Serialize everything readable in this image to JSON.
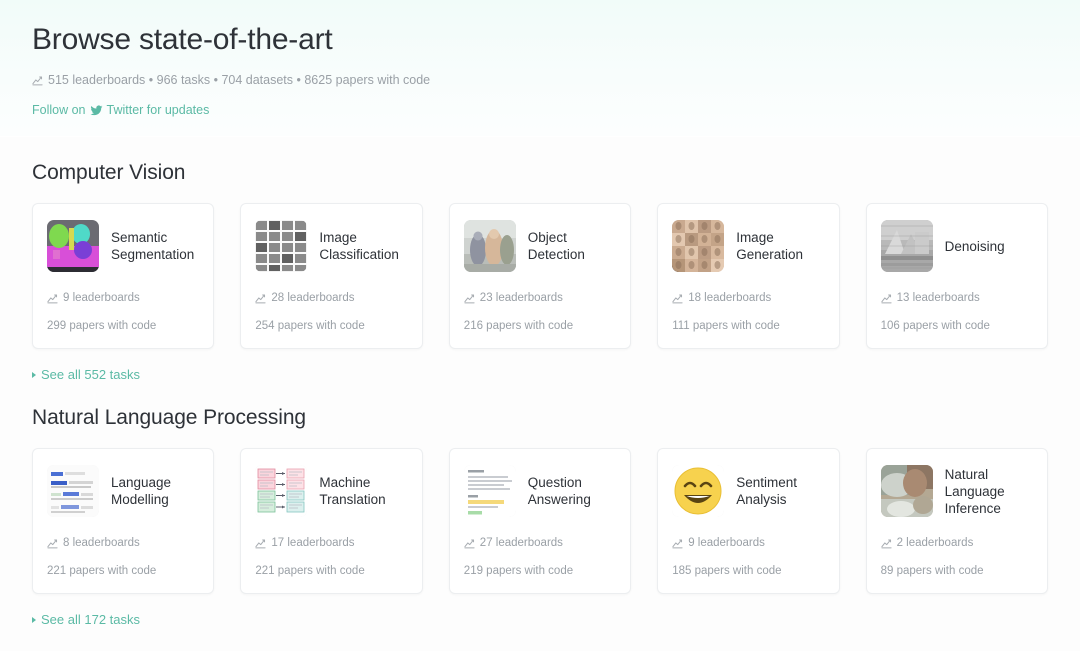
{
  "hero": {
    "title": "Browse state-of-the-art",
    "stats": "515 leaderboards • 966 tasks • 704 datasets • 8625 papers with code",
    "stats_icon": "chart-line-icon",
    "follow_prefix": "Follow on",
    "follow_icon": "twitter-icon",
    "follow_suffix": "Twitter for updates"
  },
  "sections": [
    {
      "title": "Computer Vision",
      "see_all": "See all 552 tasks",
      "cards": [
        {
          "title": "Semantic Segmentation",
          "leaderboards": "9 leaderboards",
          "papers": "299 papers with code",
          "thumb": "semantic-segmentation-thumbnail"
        },
        {
          "title": "Image Classification",
          "leaderboards": "28 leaderboards",
          "papers": "254 papers with code",
          "thumb": "image-classification-thumbnail"
        },
        {
          "title": "Object Detection",
          "leaderboards": "23 leaderboards",
          "papers": "216 papers with code",
          "thumb": "object-detection-thumbnail"
        },
        {
          "title": "Image Generation",
          "leaderboards": "18 leaderboards",
          "papers": "111 papers with code",
          "thumb": "image-generation-thumbnail"
        },
        {
          "title": "Denoising",
          "leaderboards": "13 leaderboards",
          "papers": "106 papers with code",
          "thumb": "denoising-thumbnail"
        }
      ]
    },
    {
      "title": "Natural Language Processing",
      "see_all": "See all 172 tasks",
      "cards": [
        {
          "title": "Language Modelling",
          "leaderboards": "8 leaderboards",
          "papers": "221 papers with code",
          "thumb": "language-modelling-thumbnail"
        },
        {
          "title": "Machine Translation",
          "leaderboards": "17 leaderboards",
          "papers": "221 papers with code",
          "thumb": "machine-translation-thumbnail"
        },
        {
          "title": "Question Answering",
          "leaderboards": "27 leaderboards",
          "papers": "219 papers with code",
          "thumb": "question-answering-thumbnail"
        },
        {
          "title": "Sentiment Analysis",
          "leaderboards": "9 leaderboards",
          "papers": "185 papers with code",
          "thumb": "sentiment-analysis-thumbnail"
        },
        {
          "title": "Natural Language Inference",
          "leaderboards": "2 leaderboards",
          "papers": "89 papers with code",
          "thumb": "natural-language-inference-thumbnail"
        }
      ]
    }
  ],
  "colors": {
    "accent": "#5bbaa5",
    "text": "#2e3238",
    "muted": "#9aa0a6",
    "card_border": "#eceef0"
  }
}
